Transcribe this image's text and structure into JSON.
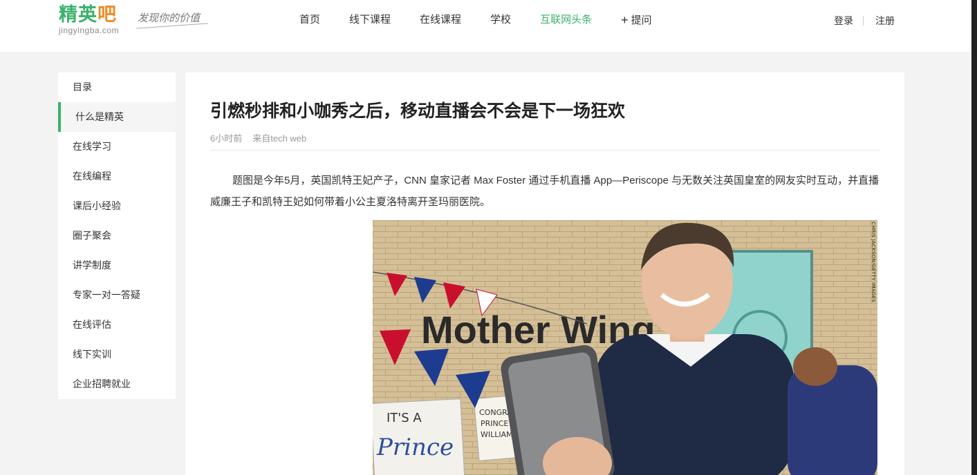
{
  "header": {
    "logo_text": "精英吧",
    "logo_domain": "jingyingba.com",
    "slogan": "发现你的价值",
    "nav": [
      {
        "label": "首页",
        "active": false
      },
      {
        "label": "线下课程",
        "active": false
      },
      {
        "label": "在线课程",
        "active": false
      },
      {
        "label": "学校",
        "active": false
      },
      {
        "label": "互联网头条",
        "active": true
      },
      {
        "label": "提问",
        "active": false,
        "icon": "plus-icon"
      }
    ],
    "login": "登录",
    "register": "注册"
  },
  "sidebar": {
    "title": "目录",
    "items": [
      {
        "label": "什么是精英",
        "active": true
      },
      {
        "label": "在线学习",
        "active": false
      },
      {
        "label": "在线编程",
        "active": false
      },
      {
        "label": "课后小经验",
        "active": false
      },
      {
        "label": "圈子聚会",
        "active": false
      },
      {
        "label": "讲学制度",
        "active": false
      },
      {
        "label": "专家一对一答疑",
        "active": false
      },
      {
        "label": "在线评估",
        "active": false
      },
      {
        "label": "线下实训",
        "active": false
      },
      {
        "label": "企业招聘就业",
        "active": false
      }
    ]
  },
  "article": {
    "title": "引燃秒排和小咖秀之后，移动直播会不会是下一场狂欢",
    "time": "6小时前",
    "source": "来自tech web",
    "paragraph": "题图是今年5月，英国凯特王妃产子，CNN 皇家记者 Max Foster 通过手机直播 App—Periscope 与无数关注英国皇室的网友实时互动，并直播威廉王子和凯特王妃如何带着小公主夏洛特离开圣玛丽医院。",
    "photo_credit": "CHRIS JACKSON/GETTY IMAGES",
    "photo_signs": [
      "Mother Wing",
      "IT'S A",
      "Prince",
      "CONGRA",
      "PRINCE",
      "WILLIAM"
    ]
  },
  "colors": {
    "brand_green": "#39b16b",
    "brand_orange": "#f08a24"
  }
}
